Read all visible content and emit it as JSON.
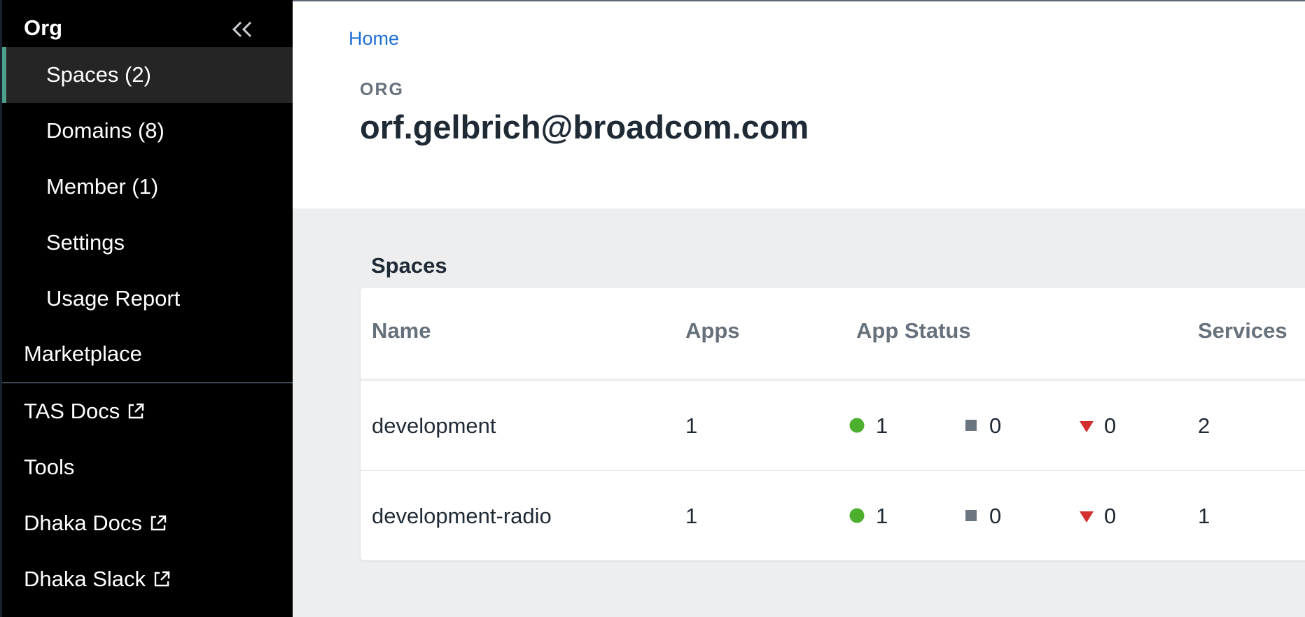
{
  "sidebar": {
    "title": "Org",
    "items": [
      {
        "label": "Spaces (2)"
      },
      {
        "label": "Domains (8)"
      },
      {
        "label": "Member (1)"
      },
      {
        "label": "Settings"
      },
      {
        "label": "Usage Report"
      }
    ],
    "marketplace": "Marketplace",
    "links": [
      {
        "label": "TAS Docs",
        "external": true
      },
      {
        "label": "Tools",
        "external": false
      },
      {
        "label": "Dhaka Docs",
        "external": true
      },
      {
        "label": "Dhaka Slack",
        "external": true
      }
    ]
  },
  "header": {
    "breadcrumb": "Home",
    "eyebrow": "ORG",
    "title": "orf.gelbrich@broadcom.com"
  },
  "spaces": {
    "section_title": "Spaces",
    "columns": [
      "Name",
      "Apps",
      "App Status",
      "Services"
    ],
    "rows": [
      {
        "name": "development",
        "apps": "1",
        "running": "1",
        "stopped": "0",
        "crashed": "0",
        "services": "2"
      },
      {
        "name": "development-radio",
        "apps": "1",
        "running": "1",
        "stopped": "0",
        "crashed": "0",
        "services": "1"
      }
    ]
  },
  "colors": {
    "running": "#4caf2e",
    "stopped": "#6a7580",
    "crashed": "#d32f2f",
    "link": "#1f6fd3",
    "active_accent": "#4d9e8c"
  },
  "icons": {
    "collapse": "double-chevron-left-icon",
    "external": "external-link-icon",
    "running": "green-circle-icon",
    "stopped": "gray-square-icon",
    "crashed": "red-triangle-icon"
  }
}
